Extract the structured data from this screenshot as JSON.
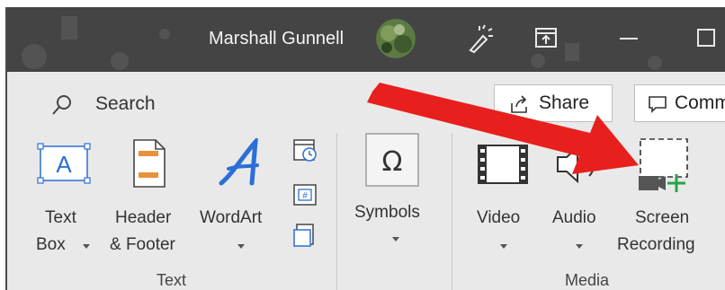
{
  "titlebar": {
    "user_name": "Marshall Gunnell"
  },
  "search": {
    "label": "Search"
  },
  "header_buttons": {
    "share": "Share",
    "comments": "Comm"
  },
  "ribbon": {
    "text_group": {
      "label": "Text",
      "text_box": {
        "line1": "Text",
        "line2": "Box"
      },
      "header_footer": {
        "line1": "Header",
        "line2": "& Footer"
      },
      "wordart": {
        "line1": "WordArt"
      }
    },
    "symbols_group": {
      "symbols": {
        "line1": "Symbols"
      }
    },
    "media_group": {
      "label": "Media",
      "video": {
        "line1": "Video"
      },
      "audio": {
        "line1": "Audio"
      },
      "screen_recording": {
        "line1": "Screen",
        "line2": "Recording"
      }
    }
  },
  "colors": {
    "titlebar_bg": "#444444",
    "ribbon_bg": "#e9e9e9",
    "accent_blue": "#2b6fd6",
    "accent_orange": "#e8923a",
    "arrow_red": "#e8201d",
    "recording_green": "#2aa24a"
  }
}
